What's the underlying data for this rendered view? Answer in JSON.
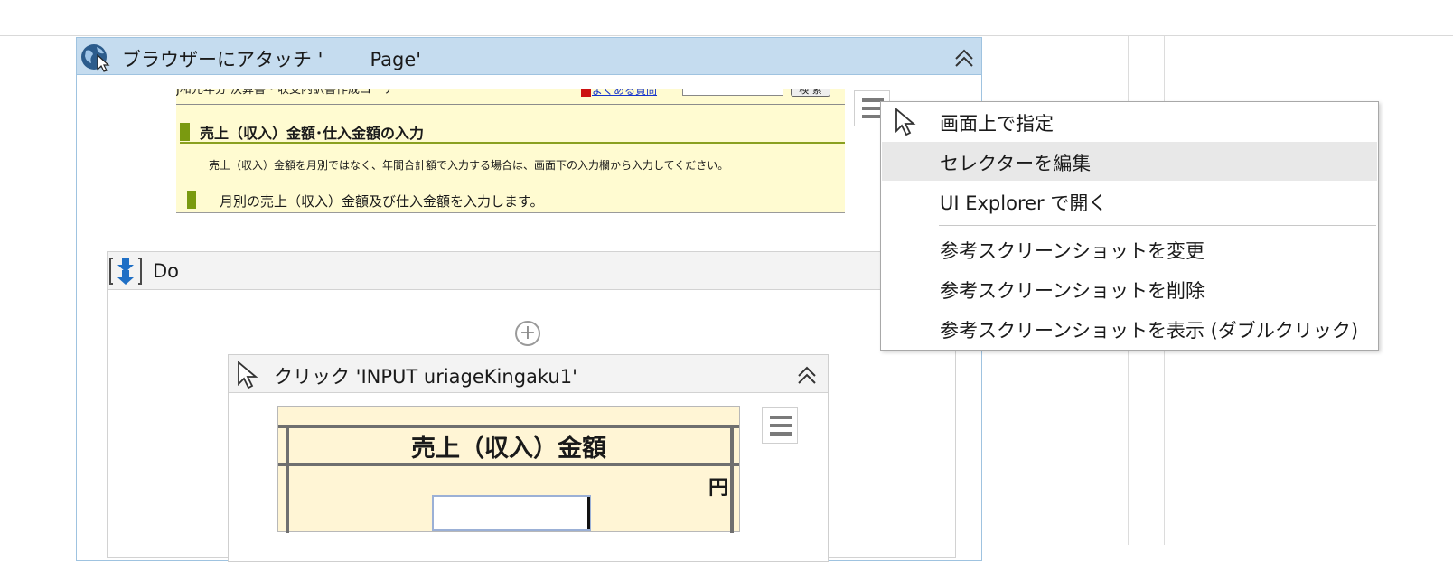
{
  "attach": {
    "title": "ブラウザーにアタッチ '",
    "title_page": "Page'"
  },
  "screenshot_top": {
    "nav_text": "J和元年分 決算書・収支内訳書作成コーナー",
    "faq_link": "よくある質問",
    "search_button": "検 索",
    "heading": "売上（収入）金額･仕入金額の入力",
    "note": "売上（収入）金額を月別ではなく、年間合計額で入力する場合は、画面下の入力欄から入力してください。",
    "subheading": "月別の売上（収入）金額及び仕入金額を入力します。"
  },
  "do": {
    "title": "Do"
  },
  "click": {
    "title": "クリック 'INPUT  uriageKingaku1'"
  },
  "screenshot_click": {
    "heading": "売上（収入）金額",
    "unit": "円"
  },
  "context_menu": {
    "items": [
      "画面上で指定",
      "セレクターを編集",
      "UI Explorer で開く",
      "参考スクリーンショットを変更",
      "参考スクリーンショットを削除",
      "参考スクリーンショットを表示 (ダブルクリック)"
    ],
    "highlighted_index": 1
  },
  "icons": {
    "attach": "globe-cursor-icon",
    "collapse": "double-chevron-up-icon",
    "do": "sequence-download-icon",
    "click": "mouse-pointer-icon",
    "menu": "hamburger-menu-icon",
    "add": "plus-circle-icon"
  }
}
